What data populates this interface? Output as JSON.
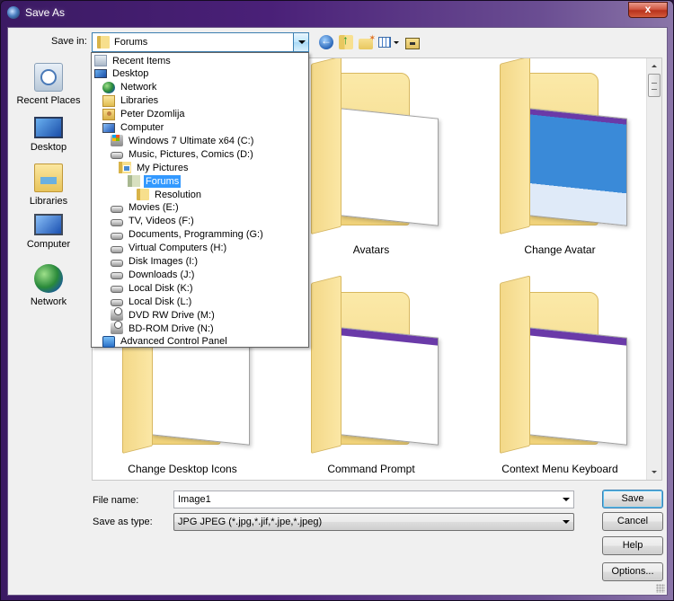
{
  "window": {
    "title": "Save As",
    "close_label": "x"
  },
  "savein": {
    "label": "Save in:",
    "value": "Forums"
  },
  "toolbar": {
    "icons": [
      "back-icon",
      "up-folder-icon",
      "new-folder-icon",
      "views-menu-icon",
      "desktop-folder-icon"
    ]
  },
  "places": [
    {
      "label": "Recent Places",
      "icon": "recent-places-icon"
    },
    {
      "label": "Desktop",
      "icon": "desktop-icon"
    },
    {
      "label": "Libraries",
      "icon": "libraries-icon"
    },
    {
      "label": "Computer",
      "icon": "computer-icon"
    },
    {
      "label": "Network",
      "icon": "network-icon"
    }
  ],
  "dropdown": {
    "items": [
      {
        "label": "Recent Items",
        "icon": "recent-items-icon",
        "indent": 0
      },
      {
        "label": "Desktop",
        "icon": "desktop-icon",
        "indent": 0
      },
      {
        "label": "Network",
        "icon": "network-icon",
        "indent": 1
      },
      {
        "label": "Libraries",
        "icon": "libraries-icon",
        "indent": 1
      },
      {
        "label": "Peter Dzomlija",
        "icon": "user-folder-icon",
        "indent": 1
      },
      {
        "label": "Computer",
        "icon": "computer-icon",
        "indent": 1
      },
      {
        "label": "Windows 7 Ultimate x64 (C:)",
        "icon": "windows-drive-icon",
        "indent": 2
      },
      {
        "label": "Music, Pictures, Comics (D:)",
        "icon": "drive-icon",
        "indent": 2
      },
      {
        "label": "My Pictures",
        "icon": "pictures-folder-icon",
        "indent": 3
      },
      {
        "label": "Forums",
        "icon": "folder-icon",
        "indent": 4,
        "selected": true
      },
      {
        "label": "Resolution",
        "icon": "folder-icon",
        "indent": 5
      },
      {
        "label": "Movies (E:)",
        "icon": "drive-icon",
        "indent": 2
      },
      {
        "label": "TV, Videos (F:)",
        "icon": "drive-icon",
        "indent": 2
      },
      {
        "label": "Documents, Programming (G:)",
        "icon": "drive-icon",
        "indent": 2
      },
      {
        "label": "Virtual Computers (H:)",
        "icon": "drive-icon",
        "indent": 2
      },
      {
        "label": "Disk Images (I:)",
        "icon": "drive-icon",
        "indent": 2
      },
      {
        "label": "Downloads (J:)",
        "icon": "drive-icon",
        "indent": 2
      },
      {
        "label": "Local Disk (K:)",
        "icon": "drive-icon",
        "indent": 2
      },
      {
        "label": "Local Disk (L:)",
        "icon": "drive-icon",
        "indent": 2
      },
      {
        "label": "DVD RW Drive (M:)",
        "icon": "optical-drive-icon",
        "indent": 2
      },
      {
        "label": "BD-ROM Drive (N:)",
        "icon": "optical-drive-icon",
        "indent": 2
      },
      {
        "label": "Advanced Control Panel",
        "icon": "control-panel-icon",
        "indent": 1
      }
    ]
  },
  "folders": [
    {
      "name": "Avatars"
    },
    {
      "name": "Change Avatar"
    },
    {
      "name": "Change Desktop Icons"
    },
    {
      "name": "Command Prompt"
    },
    {
      "name": "Context Menu Keyboard"
    }
  ],
  "filename": {
    "label": "File name:",
    "value": "Image1"
  },
  "filetype": {
    "label": "Save as type:",
    "value": "JPG JPEG  (*.jpg,*.jif,*.jpe,*.jpeg)"
  },
  "buttons": {
    "save": "Save",
    "cancel": "Cancel",
    "help": "Help",
    "options": "Options..."
  },
  "colors": {
    "frame": "#4a2078",
    "selection": "#3399ff",
    "close": "#c8402a"
  }
}
